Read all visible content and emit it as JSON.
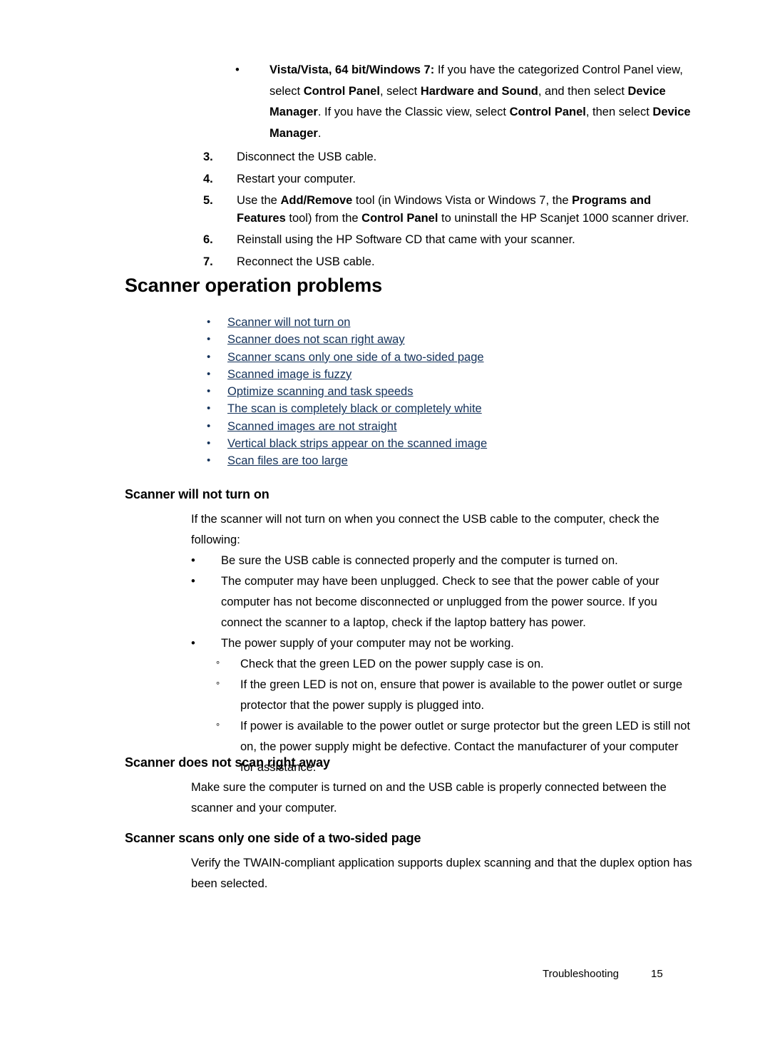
{
  "document": {
    "type": "user-guide-page",
    "page_number": "15",
    "footer": {
      "section_label": "Troubleshooting",
      "page_label": "15"
    },
    "link_color": "#14325a",
    "text_color": "#000000",
    "background_color": "#ffffff"
  },
  "procedure": {
    "bullet_item": {
      "marker": "bullet",
      "lead_bold": "Vista/Vista, 64 bit/Windows 7:",
      "text_runs": [
        {
          "text": "Vista/Vista, 64 bit/Windows 7:",
          "bold": true
        },
        {
          "text": " If you have the categorized Control Panel view, select ",
          "bold": false
        },
        {
          "text": "Control Panel",
          "bold": true
        },
        {
          "text": ", select ",
          "bold": false
        },
        {
          "text": "Hardware and Sound",
          "bold": true
        },
        {
          "text": ", and then select ",
          "bold": false
        },
        {
          "text": "Device Manager",
          "bold": true
        },
        {
          "text": ". If you have the Classic view, select ",
          "bold": false
        },
        {
          "text": "Control Panel",
          "bold": true
        },
        {
          "text": ", then select ",
          "bold": false
        },
        {
          "text": "Device Manager",
          "bold": true
        },
        {
          "text": ".",
          "bold": false
        }
      ]
    },
    "steps": [
      {
        "number": "3.",
        "text": "Disconnect the USB cable."
      },
      {
        "number": "4.",
        "text": "Restart your computer."
      },
      {
        "number": "5.",
        "text": "Use the Add/Remove tool (in Windows Vista or Windows 7, the Programs and Features tool) from the Control Panel to uninstall the HP Scanjet 1000 scanner driver."
      },
      {
        "number": "6.",
        "text": "Reinstall using the HP Software CD that came with your scanner."
      },
      {
        "number": "7.",
        "text": "Reconnect the USB cable."
      }
    ],
    "step5_runs": [
      {
        "text": "Use the ",
        "bold": false
      },
      {
        "text": "Add/Remove",
        "bold": true
      },
      {
        "text": " tool (in Windows Vista or Windows 7, the ",
        "bold": false
      },
      {
        "text": "Programs and Features",
        "bold": true
      },
      {
        "text": " tool) from the ",
        "bold": false
      },
      {
        "text": "Control Panel",
        "bold": true
      },
      {
        "text": " to uninstall the HP Scanjet 1000 scanner driver.",
        "bold": false
      }
    ]
  },
  "heading": {
    "title": "Scanner operation problems"
  },
  "links": [
    {
      "label": "Scanner will not turn on"
    },
    {
      "label": "Scanner does not scan right away"
    },
    {
      "label": "Scanner scans only one side of a two-sided page"
    },
    {
      "label": "Scanned image is fuzzy"
    },
    {
      "label": "Optimize scanning and task speeds"
    },
    {
      "label": "The scan is completely black or completely white"
    },
    {
      "label": "Scanned images are not straight"
    },
    {
      "label": "Vertical black strips appear on the scanned image"
    },
    {
      "label": "Scan files are too large"
    }
  ],
  "sections": [
    {
      "id": "scanner-will-not-turn-on",
      "title": "Scanner will not turn on",
      "intro": "If the scanner will not turn on when you connect the USB cable to the computer, check the following:",
      "bullets": [
        {
          "text": "Be sure the USB cable is connected properly and the computer is turned on."
        },
        {
          "text": "The computer may have been unplugged. Check to see that the power cable of your computer has not become disconnected or unplugged from the power source. If you connect the scanner to a laptop, check if the laptop battery has power."
        },
        {
          "text": "The power supply of your computer may not be working."
        }
      ],
      "sub_bullets": [
        {
          "text": "Check that the green LED on the power supply case is on."
        },
        {
          "text": "If the green LED is not on, ensure that power is available to the power outlet or surge protector that the power supply is plugged into."
        },
        {
          "text": "If power is available to the power outlet or surge protector but the green LED is still not on, the power supply might be defective. Contact the manufacturer of your computer for assistance."
        }
      ]
    },
    {
      "id": "scanner-does-not-scan-right-away",
      "title": "Scanner does not scan right away",
      "body": "Make sure the computer is turned on and the USB cable is properly connected between the scanner and your computer."
    },
    {
      "id": "scanner-scans-only-one-side",
      "title": "Scanner scans only one side of a two-sided page",
      "body": "Verify the TWAIN-compliant application supports duplex scanning and that the duplex option has been selected."
    }
  ],
  "glyphs": {
    "bullet": "•",
    "circle": "°"
  }
}
